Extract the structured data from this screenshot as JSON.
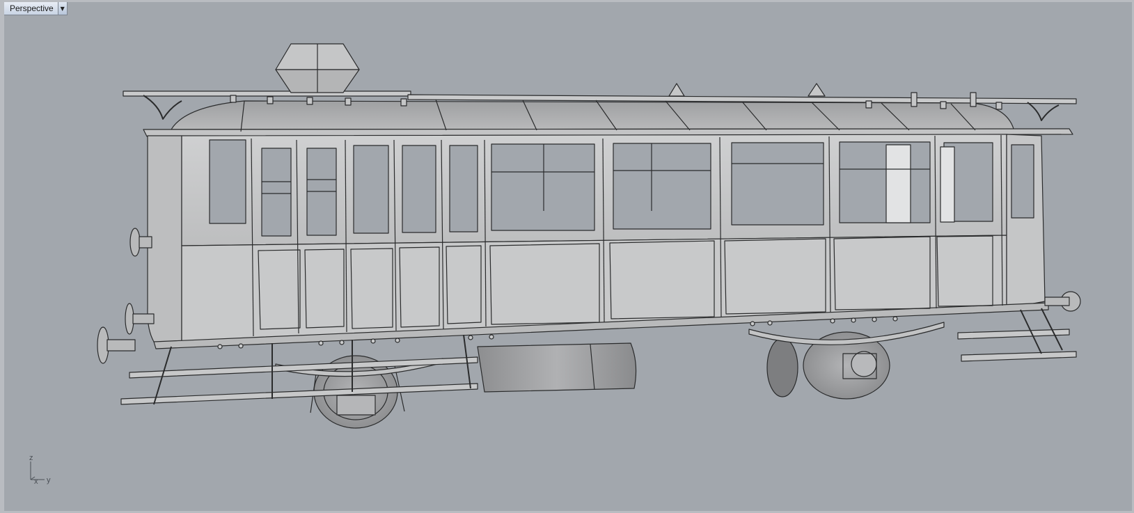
{
  "viewport": {
    "tab_label": "Perspective",
    "menu_icon": "chevron-down-icon",
    "background_color": "#a2a7ad",
    "model_color": "#c7c8c9",
    "edge_color": "#2a2b2c"
  },
  "axes": {
    "z_label": "z",
    "x_label": "x",
    "y_label": "y"
  }
}
